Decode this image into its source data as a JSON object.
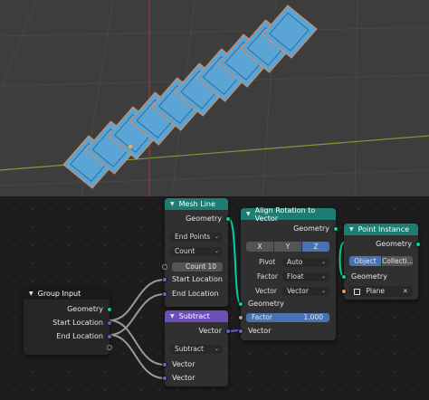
{
  "nodes": {
    "mesh_line": {
      "title": "Mesh Line",
      "output_geometry": "Geometry",
      "mode": "End Points",
      "count_method": "Count",
      "count_label": "Count",
      "count_value": "10",
      "start_location": "Start Location",
      "end_location": "End Location"
    },
    "align_rotation": {
      "title": "Align Rotation to Vector",
      "output_geometry": "Geometry",
      "axis_x": "X",
      "axis_y": "Y",
      "axis_z": "Z",
      "active_axis": "Z",
      "pivot_label": "Pivot",
      "pivot_value": "Auto",
      "factor_label": "Factor",
      "factor_type": "Float",
      "vector_label": "Vector",
      "vector_type": "Vector",
      "input_geometry": "Geometry",
      "factor_field_label": "Factor",
      "factor_field_value": "1.000",
      "input_vector": "Vector"
    },
    "point_instance": {
      "title": "Point Instance",
      "output_geometry": "Geometry",
      "tab_object": "Object",
      "tab_collection": "Collecti...",
      "input_geometry": "Geometry",
      "object_value": "Plane",
      "clear_symbol": "✕"
    },
    "group_input": {
      "title": "Group Input",
      "geometry": "Geometry",
      "start_location": "Start Location",
      "end_location": "End Location"
    },
    "subtract": {
      "title": "Subtract",
      "output_vector": "Vector",
      "operation": "Subtract",
      "input_vector_a": "Vector",
      "input_vector_b": "Vector"
    }
  },
  "colors": {
    "geometry_socket": "#00d6a3",
    "vector_socket": "#6363c7",
    "float_socket": "#a1a1a1",
    "object_socket": "#ed9e5c",
    "geometry_header": "#1e7d72",
    "vector_header": "#6a4fb6",
    "instance_color": "#5aa5d6"
  }
}
